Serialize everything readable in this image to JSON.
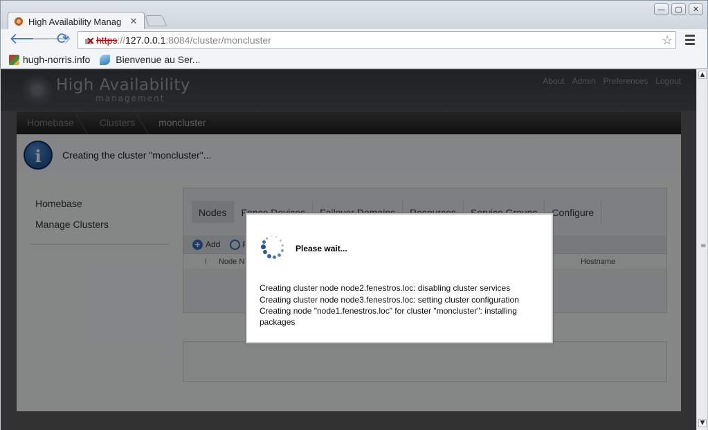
{
  "browser": {
    "tab_title": "High Availability Manag",
    "tab_close": "✕",
    "window_buttons": [
      "—",
      "▢",
      "✕"
    ],
    "url": {
      "scheme": "https",
      "separator": "://",
      "host": "127.0.0.1",
      "rest": ":8084/cluster/moncluster"
    },
    "bookmarks": [
      "hugh-norris.info",
      "Bienvenue au Ser..."
    ]
  },
  "app": {
    "logo_title": "High Availability",
    "logo_subtitle": "management",
    "top_nav": [
      "About",
      "Admin",
      "Preferences",
      "Logout"
    ],
    "breadcrumb": [
      "Homebase",
      "Clusters",
      "moncluster"
    ],
    "info_message": "Creating the cluster \"moncluster\"...",
    "sidebar": [
      "Homebase",
      "Manage Clusters"
    ],
    "tabs": [
      "Nodes",
      "Fence Devices",
      "Failover Domains",
      "Resources",
      "Service Groups",
      "Configure"
    ],
    "toolbar": {
      "add_label": "Add",
      "second_label": "F"
    },
    "table_headers": {
      "status": "!",
      "node_name": "Node Na",
      "hostname": "Hostname"
    }
  },
  "modal": {
    "title": "Please wait...",
    "lines": [
      "Creating cluster node node2.fenestros.loc: disabling cluster services",
      "Creating cluster node node3.fenestros.loc: setting cluster configuration",
      "Creating node \"node1.fenestros.loc\" for cluster \"moncluster\": installing packages"
    ]
  }
}
